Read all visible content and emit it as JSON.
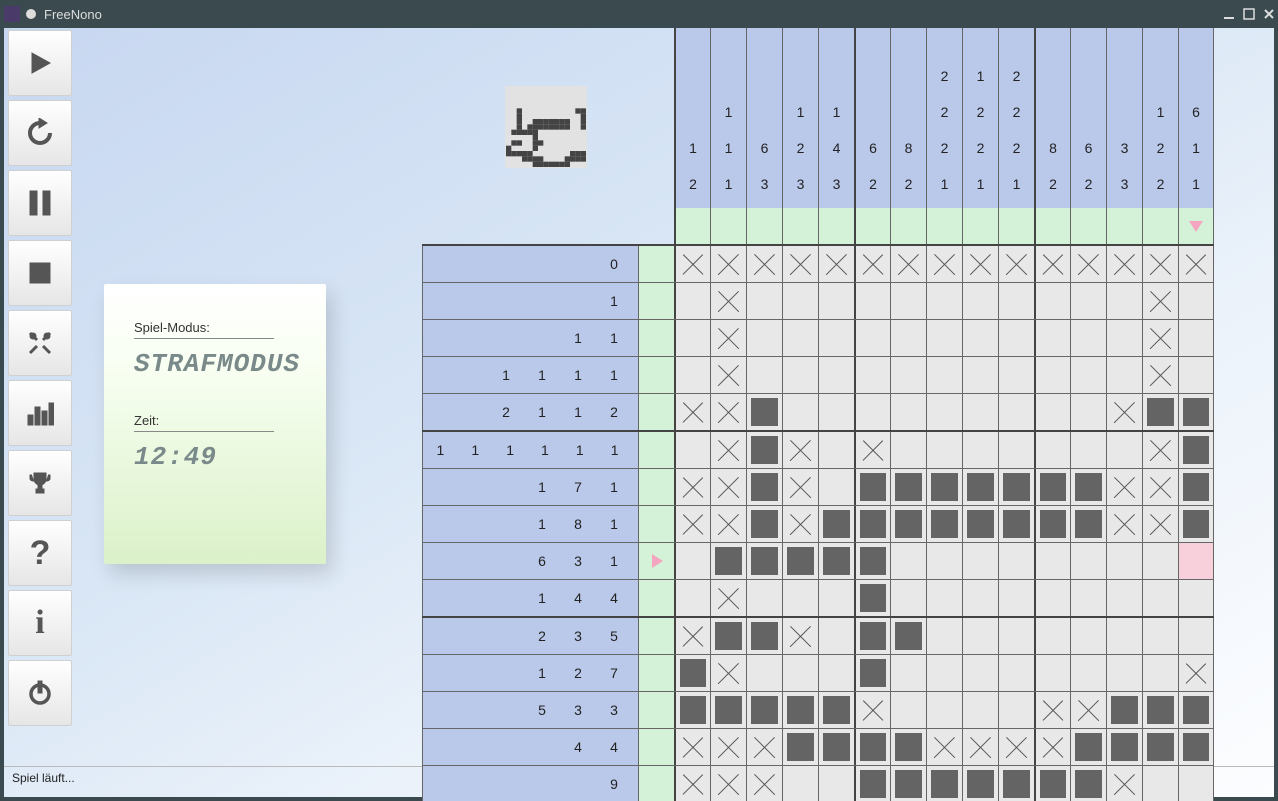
{
  "window": {
    "title": "FreeNono"
  },
  "status_bar": "Spiel läuft...",
  "info_card": {
    "mode_label": "Spiel-Modus:",
    "mode_value": "STRAFMODUS",
    "time_label": "Zeit:",
    "time_value": "12:49"
  },
  "toolbar": [
    {
      "name": "play-button"
    },
    {
      "name": "restart-button"
    },
    {
      "name": "pause-button"
    },
    {
      "name": "stop-button"
    },
    {
      "name": "settings-button"
    },
    {
      "name": "stats-button"
    },
    {
      "name": "trophy-button"
    },
    {
      "name": "help-button"
    },
    {
      "name": "info-button"
    },
    {
      "name": "power-button"
    }
  ],
  "grid": {
    "cols": 15,
    "rows": 15,
    "col_hints": [
      [
        1,
        2
      ],
      [
        1,
        1,
        1
      ],
      [
        6,
        3
      ],
      [
        1,
        2,
        3
      ],
      [
        1,
        4,
        3
      ],
      [
        6,
        2
      ],
      [
        8,
        2
      ],
      [
        2,
        2,
        2,
        1
      ],
      [
        1,
        2,
        2,
        1
      ],
      [
        2,
        2,
        2,
        1
      ],
      [
        8,
        2
      ],
      [
        6,
        2
      ],
      [
        3,
        3
      ],
      [
        1,
        2,
        2
      ],
      [
        6,
        1,
        1
      ]
    ],
    "row_hints": [
      [
        0
      ],
      [
        1
      ],
      [
        1,
        1
      ],
      [
        1,
        1,
        1,
        1
      ],
      [
        2,
        1,
        1,
        2
      ],
      [
        1,
        1,
        1,
        1,
        1,
        1
      ],
      [
        1,
        7,
        1
      ],
      [
        1,
        8,
        1
      ],
      [
        6,
        3,
        1
      ],
      [
        1,
        4,
        4
      ],
      [
        2,
        3,
        5
      ],
      [
        1,
        2,
        7
      ],
      [
        5,
        3,
        3
      ],
      [
        4,
        4
      ],
      [
        9
      ]
    ],
    "cursor": {
      "row": 8,
      "col": 14
    },
    "cells": [
      [
        "x",
        "x",
        "x",
        "x",
        "x",
        "x",
        "x",
        "x",
        "x",
        "x",
        "x",
        "x",
        "x",
        "x",
        "x"
      ],
      [
        "",
        "x",
        "",
        "",
        "",
        "",
        "",
        "",
        "",
        "",
        "",
        "",
        "",
        "x",
        ""
      ],
      [
        "",
        "x",
        "",
        "",
        "",
        "",
        "",
        "",
        "",
        "",
        "",
        "",
        "",
        "x",
        ""
      ],
      [
        "",
        "x",
        "",
        "",
        "",
        "",
        "",
        "",
        "",
        "",
        "",
        "",
        "",
        "x",
        ""
      ],
      [
        "x",
        "x",
        "f",
        "",
        "",
        "",
        "",
        "",
        "",
        "",
        "",
        "",
        "x",
        "f",
        "f"
      ],
      [
        "",
        "x",
        "f",
        "x",
        "",
        "x",
        "",
        "",
        "",
        "",
        "",
        "",
        "",
        "x",
        "f"
      ],
      [
        "x",
        "x",
        "f",
        "x",
        "",
        "f",
        "f",
        "f",
        "f",
        "f",
        "f",
        "f",
        "x",
        "x",
        "f"
      ],
      [
        "x",
        "x",
        "f",
        "x",
        "f",
        "f",
        "f",
        "f",
        "f",
        "f",
        "f",
        "f",
        "x",
        "x",
        "f"
      ],
      [
        "",
        "f",
        "f",
        "f",
        "f",
        "f",
        "",
        "",
        "",
        "",
        "",
        "",
        "",
        "",
        ""
      ],
      [
        "",
        "x",
        "",
        "",
        "",
        "f",
        "",
        "",
        "",
        "",
        "",
        "",
        "",
        "",
        ""
      ],
      [
        "x",
        "f",
        "f",
        "x",
        "",
        "f",
        "f",
        "",
        "",
        "",
        "",
        "",
        "",
        "",
        ""
      ],
      [
        "f",
        "x",
        "",
        "",
        "",
        "f",
        "",
        "",
        "",
        "",
        "",
        "",
        "",
        "",
        "x"
      ],
      [
        "f",
        "f",
        "f",
        "f",
        "f",
        "x",
        "",
        "",
        "",
        "",
        "x",
        "x",
        "f",
        "f",
        "f"
      ],
      [
        "x",
        "x",
        "x",
        "f",
        "f",
        "f",
        "f",
        "x",
        "x",
        "x",
        "x",
        "f",
        "f",
        "f",
        "f"
      ],
      [
        "x",
        "x",
        "x",
        "",
        "",
        "f",
        "f",
        "f",
        "f",
        "f",
        "f",
        "f",
        "x",
        "",
        ""
      ]
    ]
  }
}
